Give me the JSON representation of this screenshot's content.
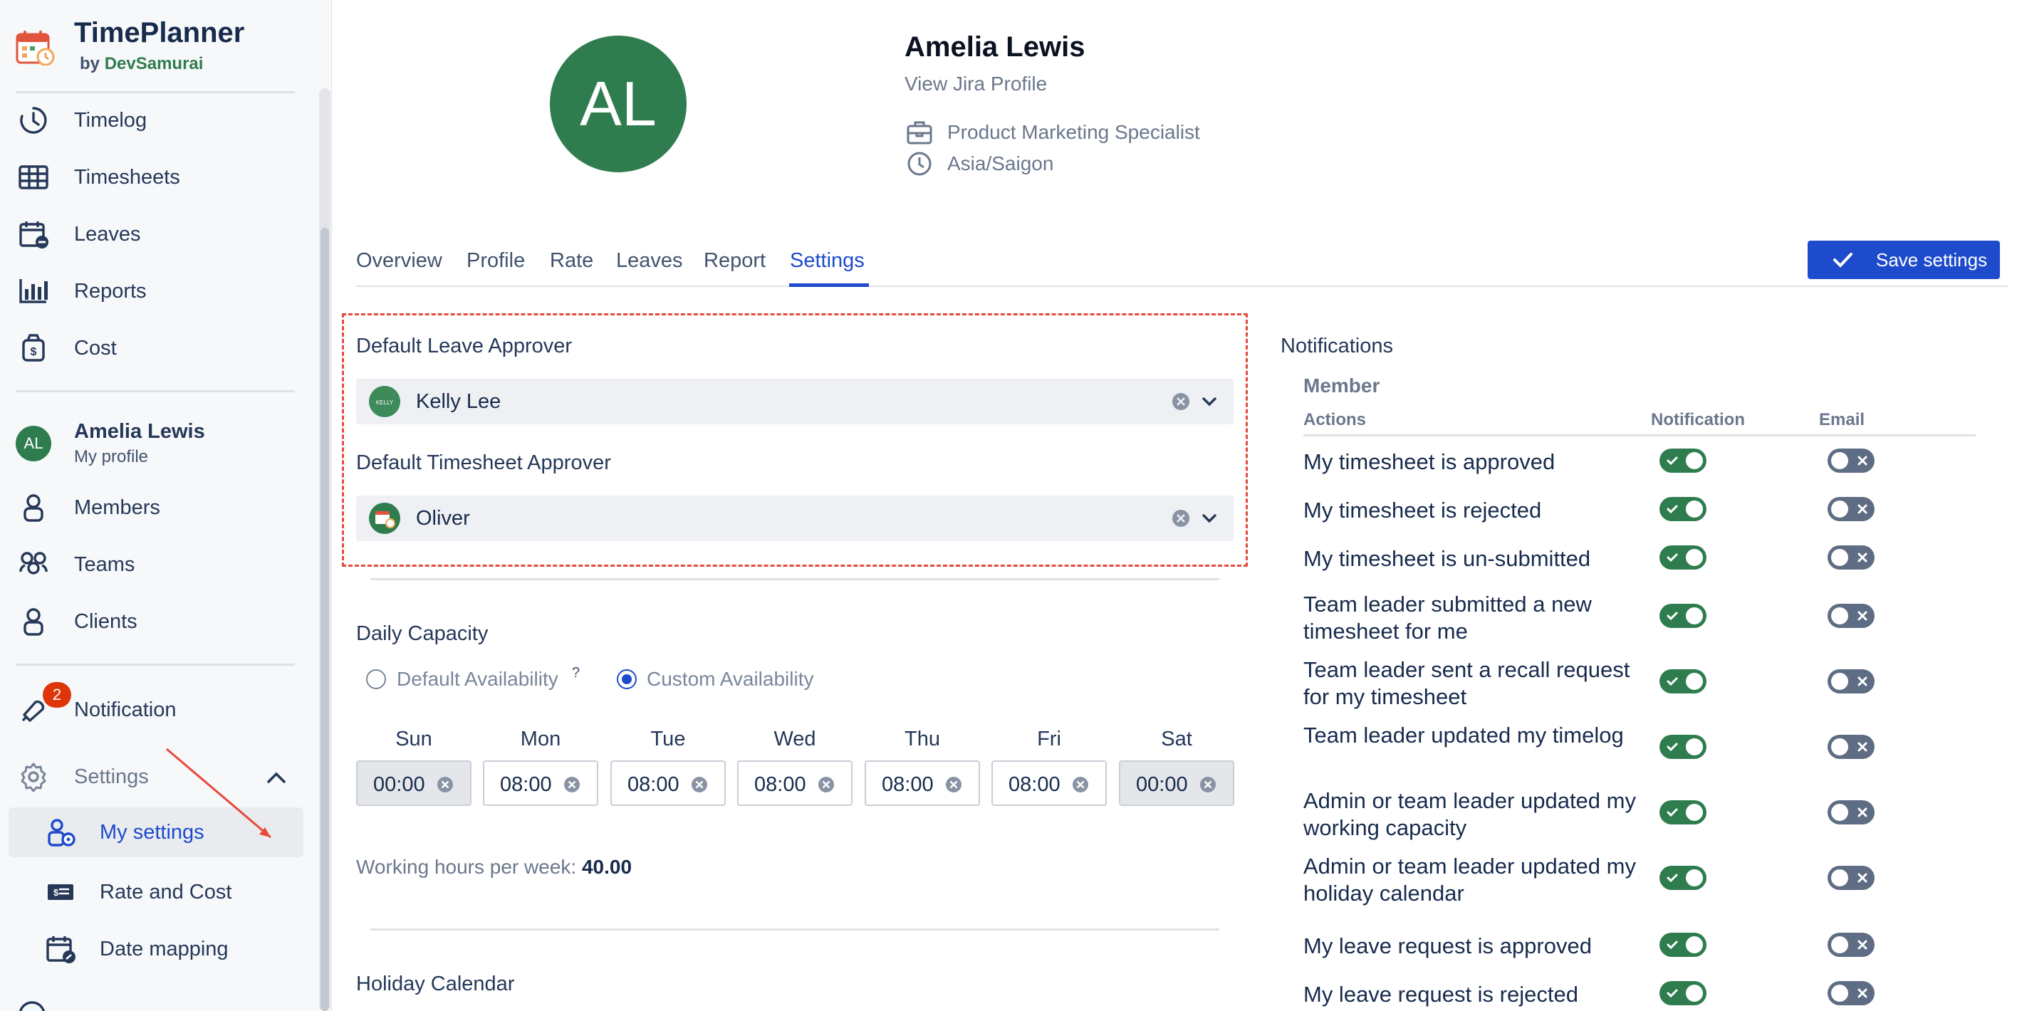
{
  "brand": {
    "name": "TimePlanner",
    "by": "by",
    "org": "DevSamurai"
  },
  "sidebar": {
    "items": [
      {
        "key": "timelog",
        "label": "Timelog",
        "icon": "clock-icon"
      },
      {
        "key": "timesheets",
        "label": "Timesheets",
        "icon": "table-icon"
      },
      {
        "key": "leaves",
        "label": "Leaves",
        "icon": "calendar-minus-icon"
      },
      {
        "key": "reports",
        "label": "Reports",
        "icon": "bar-chart-icon"
      },
      {
        "key": "cost",
        "label": "Cost",
        "icon": "money-bag-icon"
      }
    ],
    "me": {
      "initials": "AL",
      "name": "Amelia Lewis",
      "sub": "My profile"
    },
    "manage": [
      {
        "key": "members",
        "label": "Members",
        "icon": "person-icon"
      },
      {
        "key": "teams",
        "label": "Teams",
        "icon": "people-icon"
      },
      {
        "key": "clients",
        "label": "Clients",
        "icon": "person-icon"
      }
    ],
    "notification": {
      "label": "Notification",
      "badge": "2"
    },
    "settings": {
      "label": "Settings",
      "sub": [
        {
          "key": "my-settings",
          "label": "My settings",
          "active": true
        },
        {
          "key": "rate-and-cost",
          "label": "Rate and Cost"
        },
        {
          "key": "date-mapping",
          "label": "Date mapping"
        }
      ]
    }
  },
  "profile": {
    "initials": "AL",
    "name": "Amelia Lewis",
    "jira_link": "View Jira Profile",
    "job_title": "Product Marketing Specialist",
    "timezone": "Asia/Saigon"
  },
  "tabs": [
    "Overview",
    "Profile",
    "Rate",
    "Leaves",
    "Report",
    "Settings"
  ],
  "active_tab": "Settings",
  "save_label": "Save settings",
  "approvers": {
    "leave_label": "Default Leave Approver",
    "leave_value": "Kelly Lee",
    "leave_avatar_text": "KELLY",
    "timesheet_label": "Default Timesheet Approver",
    "timesheet_value": "Oliver"
  },
  "capacity": {
    "label": "Daily Capacity",
    "option_default": "Default Availability",
    "option_default_hint": "?",
    "option_custom": "Custom Availability",
    "selected": "custom",
    "days": [
      {
        "day": "Sun",
        "value": "00:00",
        "disabled": true
      },
      {
        "day": "Mon",
        "value": "08:00",
        "disabled": false
      },
      {
        "day": "Tue",
        "value": "08:00",
        "disabled": false
      },
      {
        "day": "Wed",
        "value": "08:00",
        "disabled": false
      },
      {
        "day": "Thu",
        "value": "08:00",
        "disabled": false
      },
      {
        "day": "Fri",
        "value": "08:00",
        "disabled": false
      },
      {
        "day": "Sat",
        "value": "00:00",
        "disabled": true
      }
    ],
    "weekly_label": "Working hours per week:",
    "weekly_value": "40.00"
  },
  "holiday_label": "Holiday Calendar",
  "notifications": {
    "title": "Notifications",
    "group": "Member",
    "col_actions": "Actions",
    "col_notification": "Notification",
    "col_email": "Email",
    "rows": [
      {
        "action": "My timesheet is approved",
        "notification": true,
        "email": false
      },
      {
        "action": "My timesheet is rejected",
        "notification": true,
        "email": false
      },
      {
        "action": "My timesheet is un-submitted",
        "notification": true,
        "email": false
      },
      {
        "action": "Team leader submitted a new timesheet for me",
        "notification": true,
        "email": false
      },
      {
        "action": "Team leader sent a recall request for my timesheet",
        "notification": true,
        "email": false
      },
      {
        "action": "Team leader updated my timelog",
        "notification": true,
        "email": false
      },
      {
        "action": "Admin or team leader updated my working capacity",
        "notification": true,
        "email": false
      },
      {
        "action": "Admin or team leader updated my holiday calendar",
        "notification": true,
        "email": false
      },
      {
        "action": "My leave request is approved",
        "notification": true,
        "email": false
      },
      {
        "action": "My leave request is rejected",
        "notification": true,
        "email": false
      }
    ]
  },
  "colors": {
    "primary": "#1d4bcc",
    "brand_green": "#2f7d4f",
    "annotation_red": "#e64a3b"
  }
}
